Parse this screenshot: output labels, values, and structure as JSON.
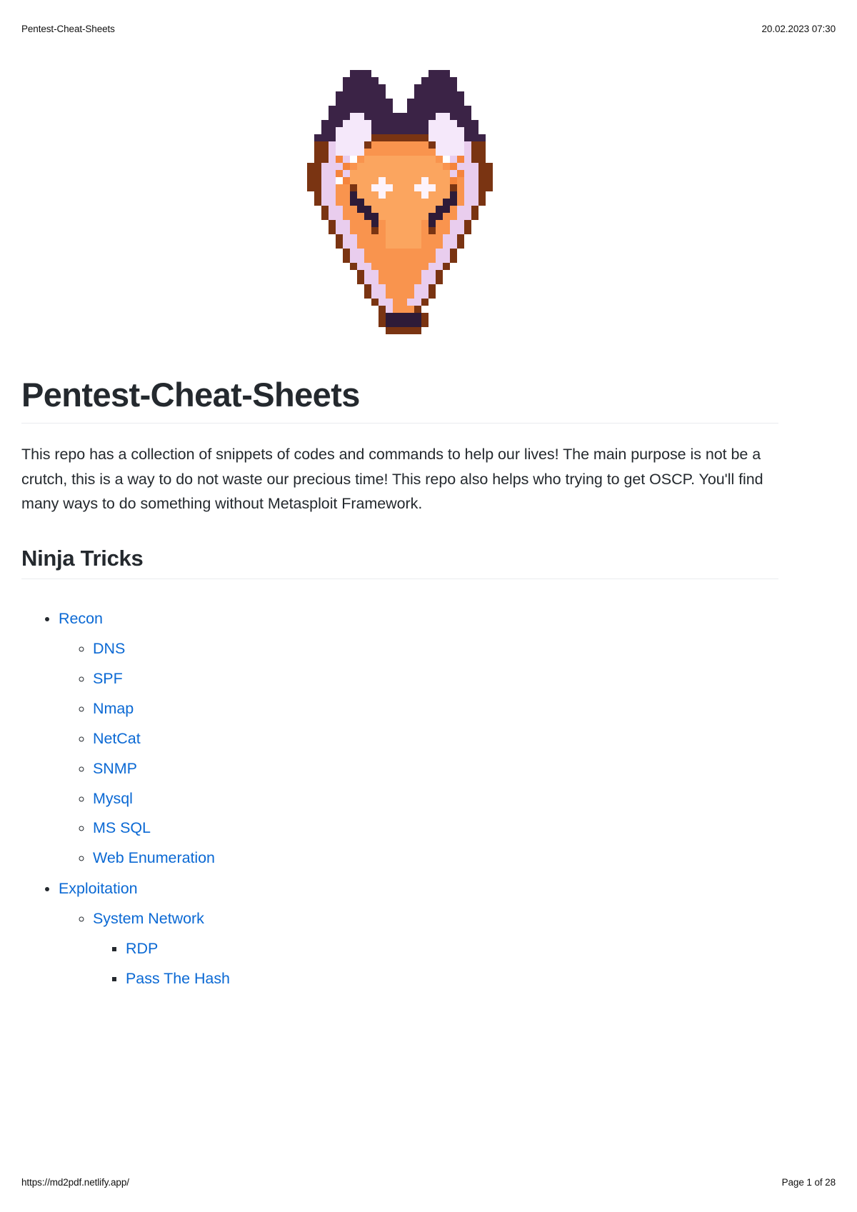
{
  "header": {
    "doc_name": "Pentest-Cheat-Sheets",
    "timestamp": "20.02.2023 07:30"
  },
  "footer": {
    "url": "https://md2pdf.netlify.app/",
    "page_label": "Page 1 of 28"
  },
  "logo": {
    "alt": "pixel-art-fox-logo",
    "colors": {
      "ear_dark": "#3b2346",
      "ear_inner": "#f5e8fa",
      "face_orange": "#f9944e",
      "face_light": "#fba55f",
      "face_shadow": "#f5843c",
      "outline_brown": "#7a3412",
      "cheek_lavender": "#e9cdee",
      "eye_white": "#fdf3fb",
      "nose_dark": "#2e1b38"
    }
  },
  "main": {
    "title": "Pentest-Cheat-Sheets",
    "intro": "This repo has a collection of snippets of codes and commands to help our lives! The main purpose is not be a crutch, this is a way to do not waste our precious time! This repo also helps who trying to get OSCP. You'll find many ways to do something without Metasploit Framework.",
    "section_heading": "Ninja Tricks",
    "toc": [
      {
        "label": "Recon",
        "children": [
          {
            "label": "DNS"
          },
          {
            "label": "SPF"
          },
          {
            "label": "Nmap"
          },
          {
            "label": "NetCat"
          },
          {
            "label": "SNMP"
          },
          {
            "label": "Mysql"
          },
          {
            "label": "MS SQL"
          },
          {
            "label": "Web Enumeration"
          }
        ]
      },
      {
        "label": "Exploitation",
        "children": [
          {
            "label": "System Network",
            "children": [
              {
                "label": "RDP"
              },
              {
                "label": "Pass The Hash"
              }
            ]
          }
        ]
      }
    ]
  },
  "colors": {
    "link": "#0b69d4",
    "text": "#24292e",
    "rule": "#eaecef"
  }
}
